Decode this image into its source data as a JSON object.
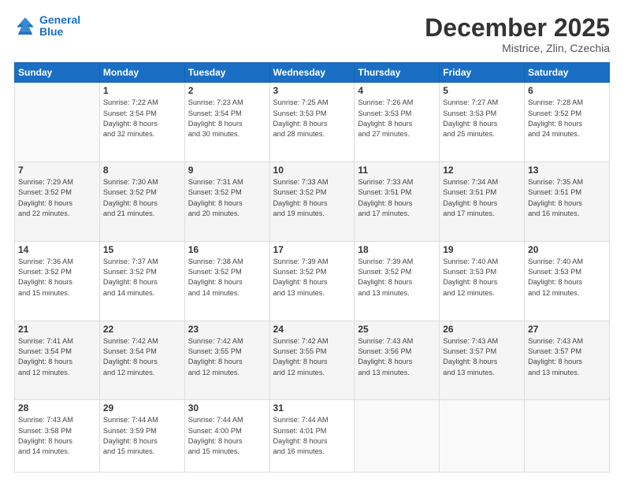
{
  "header": {
    "logo_line1": "General",
    "logo_line2": "Blue",
    "month": "December 2025",
    "location": "Mistrice, Zlin, Czechia"
  },
  "weekdays": [
    "Sunday",
    "Monday",
    "Tuesday",
    "Wednesday",
    "Thursday",
    "Friday",
    "Saturday"
  ],
  "weeks": [
    [
      {
        "day": "",
        "info": ""
      },
      {
        "day": "1",
        "info": "Sunrise: 7:22 AM\nSunset: 3:54 PM\nDaylight: 8 hours\nand 32 minutes."
      },
      {
        "day": "2",
        "info": "Sunrise: 7:23 AM\nSunset: 3:54 PM\nDaylight: 8 hours\nand 30 minutes."
      },
      {
        "day": "3",
        "info": "Sunrise: 7:25 AM\nSunset: 3:53 PM\nDaylight: 8 hours\nand 28 minutes."
      },
      {
        "day": "4",
        "info": "Sunrise: 7:26 AM\nSunset: 3:53 PM\nDaylight: 8 hours\nand 27 minutes."
      },
      {
        "day": "5",
        "info": "Sunrise: 7:27 AM\nSunset: 3:53 PM\nDaylight: 8 hours\nand 25 minutes."
      },
      {
        "day": "6",
        "info": "Sunrise: 7:28 AM\nSunset: 3:52 PM\nDaylight: 8 hours\nand 24 minutes."
      }
    ],
    [
      {
        "day": "7",
        "info": "Sunrise: 7:29 AM\nSunset: 3:52 PM\nDaylight: 8 hours\nand 22 minutes."
      },
      {
        "day": "8",
        "info": "Sunrise: 7:30 AM\nSunset: 3:52 PM\nDaylight: 8 hours\nand 21 minutes."
      },
      {
        "day": "9",
        "info": "Sunrise: 7:31 AM\nSunset: 3:52 PM\nDaylight: 8 hours\nand 20 minutes."
      },
      {
        "day": "10",
        "info": "Sunrise: 7:33 AM\nSunset: 3:52 PM\nDaylight: 8 hours\nand 19 minutes."
      },
      {
        "day": "11",
        "info": "Sunrise: 7:33 AM\nSunset: 3:51 PM\nDaylight: 8 hours\nand 17 minutes."
      },
      {
        "day": "12",
        "info": "Sunrise: 7:34 AM\nSunset: 3:51 PM\nDaylight: 8 hours\nand 17 minutes."
      },
      {
        "day": "13",
        "info": "Sunrise: 7:35 AM\nSunset: 3:51 PM\nDaylight: 8 hours\nand 16 minutes."
      }
    ],
    [
      {
        "day": "14",
        "info": "Sunrise: 7:36 AM\nSunset: 3:52 PM\nDaylight: 8 hours\nand 15 minutes."
      },
      {
        "day": "15",
        "info": "Sunrise: 7:37 AM\nSunset: 3:52 PM\nDaylight: 8 hours\nand 14 minutes."
      },
      {
        "day": "16",
        "info": "Sunrise: 7:38 AM\nSunset: 3:52 PM\nDaylight: 8 hours\nand 14 minutes."
      },
      {
        "day": "17",
        "info": "Sunrise: 7:39 AM\nSunset: 3:52 PM\nDaylight: 8 hours\nand 13 minutes."
      },
      {
        "day": "18",
        "info": "Sunrise: 7:39 AM\nSunset: 3:52 PM\nDaylight: 8 hours\nand 13 minutes."
      },
      {
        "day": "19",
        "info": "Sunrise: 7:40 AM\nSunset: 3:53 PM\nDaylight: 8 hours\nand 12 minutes."
      },
      {
        "day": "20",
        "info": "Sunrise: 7:40 AM\nSunset: 3:53 PM\nDaylight: 8 hours\nand 12 minutes."
      }
    ],
    [
      {
        "day": "21",
        "info": "Sunrise: 7:41 AM\nSunset: 3:54 PM\nDaylight: 8 hours\nand 12 minutes."
      },
      {
        "day": "22",
        "info": "Sunrise: 7:42 AM\nSunset: 3:54 PM\nDaylight: 8 hours\nand 12 minutes."
      },
      {
        "day": "23",
        "info": "Sunrise: 7:42 AM\nSunset: 3:55 PM\nDaylight: 8 hours\nand 12 minutes."
      },
      {
        "day": "24",
        "info": "Sunrise: 7:42 AM\nSunset: 3:55 PM\nDaylight: 8 hours\nand 12 minutes."
      },
      {
        "day": "25",
        "info": "Sunrise: 7:43 AM\nSunset: 3:56 PM\nDaylight: 8 hours\nand 13 minutes."
      },
      {
        "day": "26",
        "info": "Sunrise: 7:43 AM\nSunset: 3:57 PM\nDaylight: 8 hours\nand 13 minutes."
      },
      {
        "day": "27",
        "info": "Sunrise: 7:43 AM\nSunset: 3:57 PM\nDaylight: 8 hours\nand 13 minutes."
      }
    ],
    [
      {
        "day": "28",
        "info": "Sunrise: 7:43 AM\nSunset: 3:58 PM\nDaylight: 8 hours\nand 14 minutes."
      },
      {
        "day": "29",
        "info": "Sunrise: 7:44 AM\nSunset: 3:59 PM\nDaylight: 8 hours\nand 15 minutes."
      },
      {
        "day": "30",
        "info": "Sunrise: 7:44 AM\nSunset: 4:00 PM\nDaylight: 8 hours\nand 15 minutes."
      },
      {
        "day": "31",
        "info": "Sunrise: 7:44 AM\nSunset: 4:01 PM\nDaylight: 8 hours\nand 16 minutes."
      },
      {
        "day": "",
        "info": ""
      },
      {
        "day": "",
        "info": ""
      },
      {
        "day": "",
        "info": ""
      }
    ]
  ]
}
